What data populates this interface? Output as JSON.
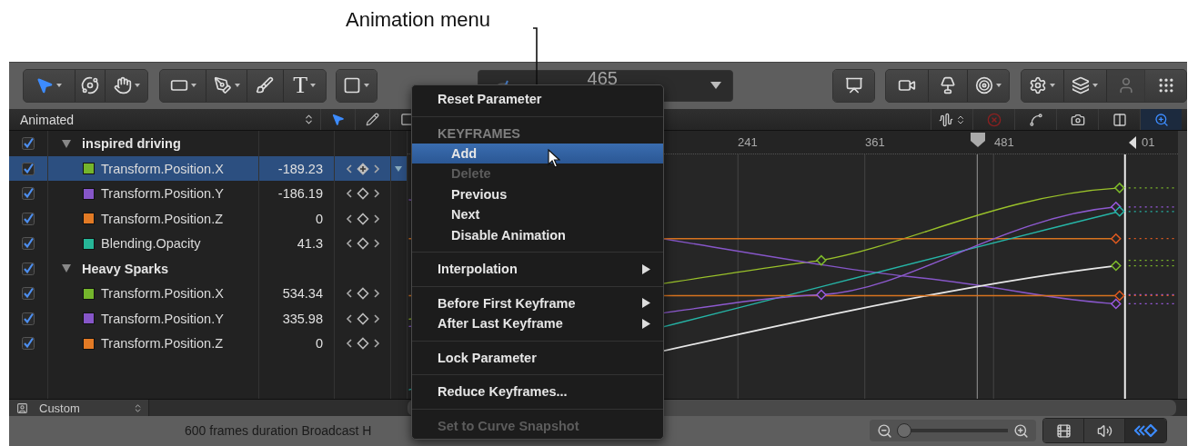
{
  "callout": {
    "label": "Animation menu"
  },
  "toolbar": {
    "groups": [
      {
        "tools": [
          {
            "selected": true,
            "menu": true
          },
          {
            "selected": false,
            "menu": false
          },
          {
            "selected": false,
            "menu": true
          }
        ]
      },
      {
        "tools": [
          {
            "selected": false,
            "menu": true
          },
          {
            "selected": false,
            "menu": true
          },
          {
            "selected": false,
            "menu": false
          },
          {
            "selected": false,
            "menu": true,
            "glyph": "T"
          }
        ]
      },
      {
        "tools": [
          {
            "selected": false,
            "menu": true
          }
        ]
      }
    ],
    "timecode": {
      "value": "465"
    },
    "right_groups": [
      {
        "tools": [
          {
            "disabled": false,
            "menu": false
          }
        ]
      },
      {
        "tools": [
          {
            "disabled": false,
            "menu": false
          },
          {
            "disabled": false,
            "menu": false
          },
          {
            "disabled": false,
            "menu": true
          }
        ]
      },
      {
        "tools": [
          {
            "disabled": false,
            "menu": true
          },
          {
            "disabled": false,
            "menu": true
          },
          {
            "disabled": true,
            "menu": false
          },
          {
            "disabled": false,
            "menu": false
          }
        ]
      }
    ]
  },
  "header": {
    "filter": "Animated",
    "tools": [
      {
        "selected": true
      },
      {
        "selected": false
      },
      {
        "selected": false
      }
    ],
    "graph_tools": [
      {
        "selected": false
      },
      {
        "selected": false
      },
      {
        "selected": false
      },
      {
        "selected": false
      },
      {
        "selected": false
      },
      {
        "selected": true
      }
    ]
  },
  "layers": [
    {
      "name": "inspired driving",
      "checked": true,
      "expanded": true,
      "selected": false,
      "children": [
        {
          "name": "Transform.Position.X",
          "color": "#74b52c",
          "value": "-189.23",
          "checked": true,
          "selected": true,
          "on_keyframe": true
        },
        {
          "name": "Transform.Position.Y",
          "color": "#8656c8",
          "value": "-186.19",
          "checked": true,
          "selected": false,
          "on_keyframe": false
        },
        {
          "name": "Transform.Position.Z",
          "color": "#e27a25",
          "value": "0",
          "checked": true,
          "selected": false,
          "on_keyframe": false
        },
        {
          "name": "Blending.Opacity",
          "color": "#26b597",
          "value": "41.3",
          "checked": true,
          "selected": false,
          "on_keyframe": false
        }
      ]
    },
    {
      "name": "Heavy Sparks",
      "checked": true,
      "expanded": true,
      "selected": false,
      "children": [
        {
          "name": "Transform.Position.X",
          "color": "#74b52c",
          "value": "534.34",
          "checked": true,
          "selected": false,
          "on_keyframe": false
        },
        {
          "name": "Transform.Position.Y",
          "color": "#8656c8",
          "value": "335.98",
          "checked": true,
          "selected": false,
          "on_keyframe": false
        },
        {
          "name": "Transform.Position.Z",
          "color": "#e27a25",
          "value": "0",
          "checked": true,
          "selected": false,
          "on_keyframe": false
        }
      ]
    }
  ],
  "ruler": {
    "labels": [
      "241",
      "361",
      "481",
      "01"
    ]
  },
  "preset": {
    "label": "Custom"
  },
  "status": {
    "text": "600 frames duration Broadcast H",
    "zoom": {
      "level": 0.05
    },
    "view_buttons": [
      {
        "selected": false
      },
      {
        "selected": false
      },
      {
        "selected": true
      }
    ]
  },
  "menu": {
    "items": [
      {
        "kind": "item",
        "label": "Reset Parameter",
        "selected": false,
        "disabled": false,
        "submenu": false
      },
      {
        "kind": "separator"
      },
      {
        "kind": "header",
        "label": "KEYFRAMES",
        "children": [
          {
            "label": "Add",
            "selected": true,
            "disabled": false,
            "submenu": false
          },
          {
            "label": "Delete",
            "selected": false,
            "disabled": true,
            "submenu": false
          },
          {
            "label": "Previous",
            "selected": false,
            "disabled": false,
            "submenu": false
          },
          {
            "label": "Next",
            "selected": false,
            "disabled": false,
            "submenu": false
          },
          {
            "label": "Disable Animation",
            "selected": false,
            "disabled": false,
            "submenu": false
          }
        ]
      },
      {
        "kind": "separator"
      },
      {
        "kind": "item",
        "label": "Interpolation",
        "selected": false,
        "disabled": false,
        "submenu": true
      },
      {
        "kind": "separator"
      },
      {
        "kind": "item",
        "label": "Before First Keyframe",
        "selected": false,
        "disabled": false,
        "submenu": true
      },
      {
        "kind": "item",
        "label": "After Last Keyframe",
        "selected": false,
        "disabled": false,
        "submenu": true
      },
      {
        "kind": "separator"
      },
      {
        "kind": "item",
        "label": "Lock Parameter",
        "selected": false,
        "disabled": false,
        "submenu": false
      },
      {
        "kind": "separator"
      },
      {
        "kind": "item",
        "label": "Reduce Keyframes...",
        "selected": false,
        "disabled": false,
        "submenu": false
      },
      {
        "kind": "separator"
      },
      {
        "kind": "item",
        "label": "Set to Curve Snapshot",
        "selected": false,
        "disabled": true,
        "submenu": false
      }
    ]
  }
}
